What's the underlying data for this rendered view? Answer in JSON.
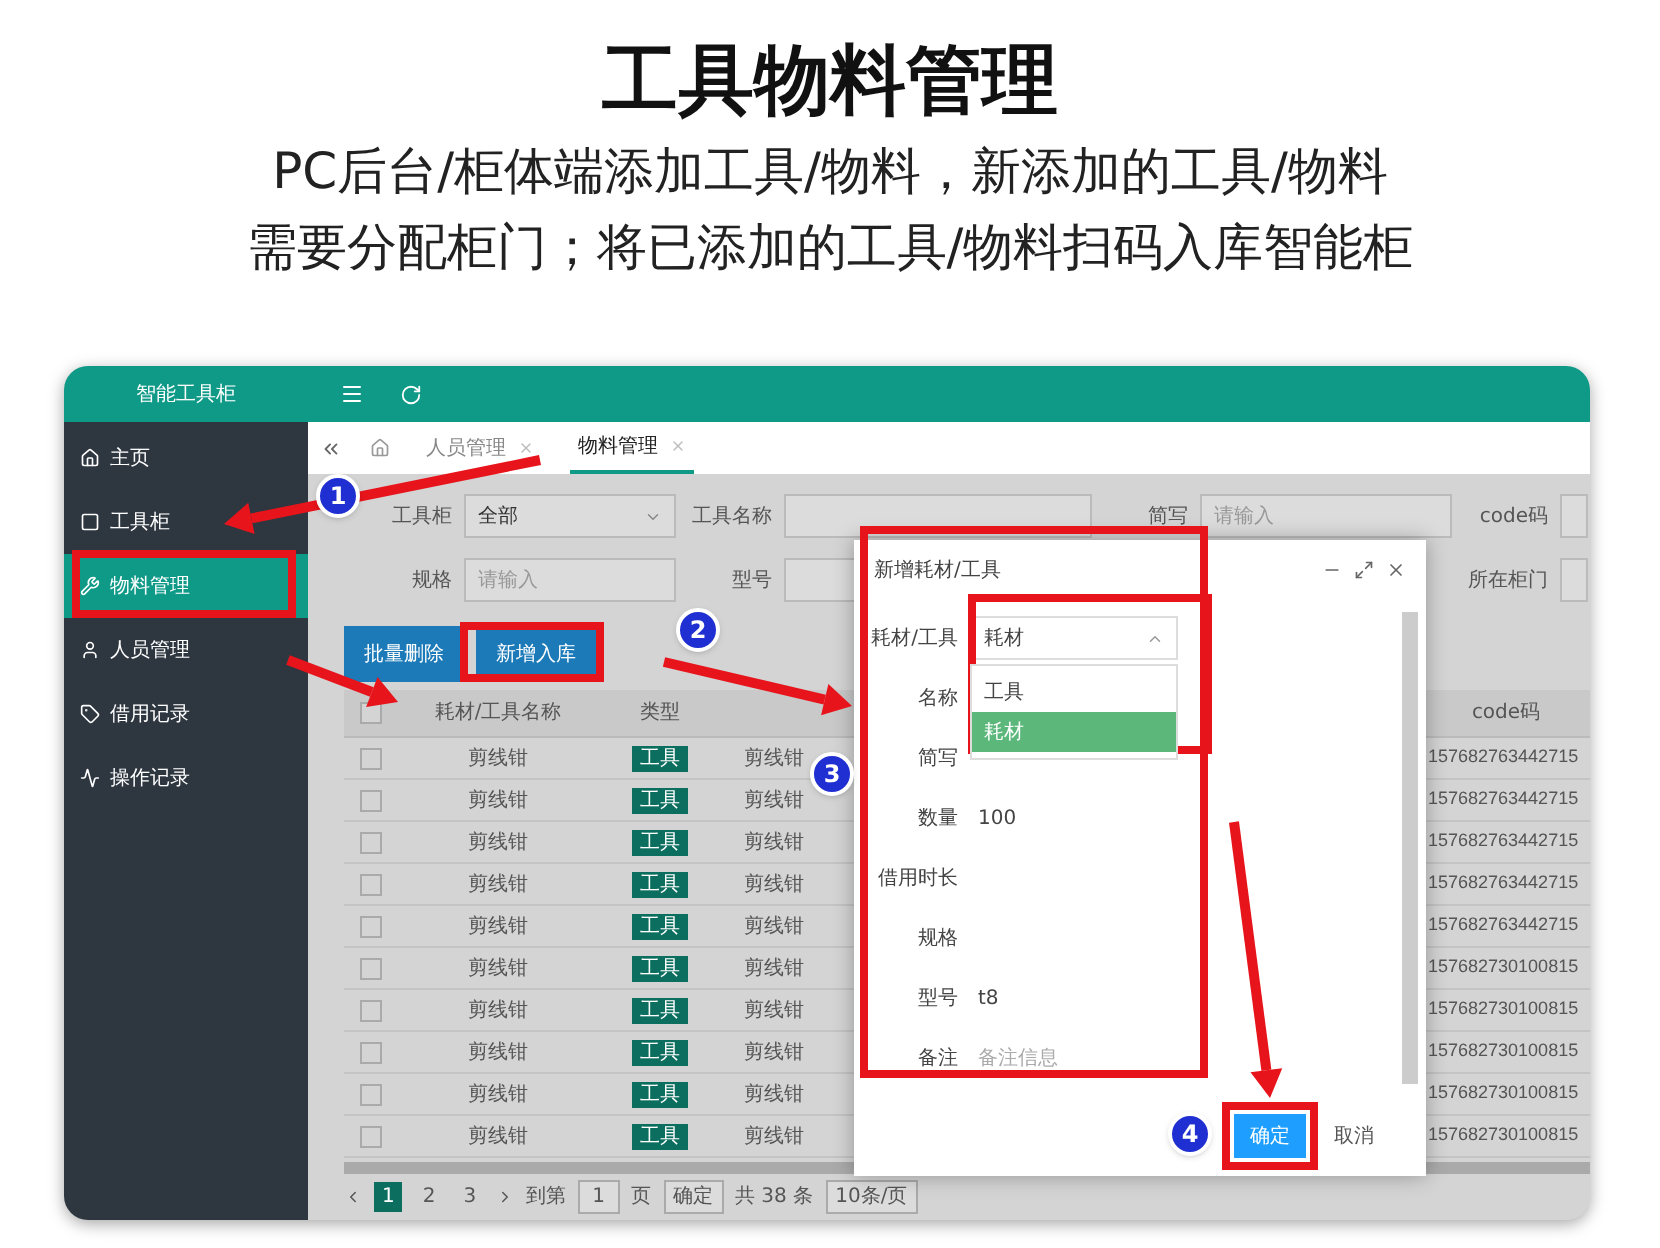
{
  "headline": {
    "title": "工具物料管理",
    "lines": [
      "PC后台/柜体端添加工具/物料，新添加的工具/物料",
      "需要分配柜门；将已添加的工具/物料扫码入库智能柜"
    ]
  },
  "app": {
    "title": "智能工具柜"
  },
  "sidebar": {
    "items": [
      {
        "label": "主页",
        "selected": false
      },
      {
        "label": "工具柜",
        "selected": false
      },
      {
        "label": "物料管理",
        "selected": true
      },
      {
        "label": "人员管理",
        "selected": false
      },
      {
        "label": "借用记录",
        "selected": false
      },
      {
        "label": "操作记录",
        "selected": false
      }
    ]
  },
  "tabs": [
    {
      "label": "人员管理",
      "selected": false
    },
    {
      "label": "物料管理",
      "selected": true
    }
  ],
  "filters": [
    [
      {
        "label": "工具柜",
        "kind": "select",
        "value": "全部"
      },
      {
        "label": "工具名称",
        "kind": "input"
      },
      {
        "label": "简写",
        "kind": "input",
        "placeholder": "请输入"
      },
      {
        "label": "code码",
        "kind": "input"
      }
    ],
    [
      {
        "label": "规格",
        "kind": "input",
        "placeholder": "请输入"
      },
      {
        "label": "型号",
        "kind": "input"
      },
      {
        "label": "所在柜门",
        "kind": "input"
      }
    ]
  ],
  "actions": [
    "批量删除",
    "新增入库"
  ],
  "table": {
    "columns": [
      "耗材/工具名称",
      "类型",
      "code码"
    ],
    "all_checked": false,
    "rows": [
      {
        "checked": false,
        "name": "剪线钳",
        "type": "工具",
        "column_3": "剪线钳",
        "code": "157682763442715"
      },
      {
        "checked": false,
        "name": "剪线钳",
        "type": "工具",
        "column_3": "剪线钳",
        "code": "157682763442715"
      },
      {
        "checked": false,
        "name": "剪线钳",
        "type": "工具",
        "column_3": "剪线钳",
        "code": "157682763442715"
      },
      {
        "checked": false,
        "name": "剪线钳",
        "type": "工具",
        "column_3": "剪线钳",
        "code": "157682763442715"
      },
      {
        "checked": false,
        "name": "剪线钳",
        "type": "工具",
        "column_3": "剪线钳",
        "code": "157682763442715"
      },
      {
        "checked": false,
        "name": "剪线钳",
        "type": "工具",
        "column_3": "剪线钳",
        "code": "157682730100815"
      },
      {
        "checked": false,
        "name": "剪线钳",
        "type": "工具",
        "column_3": "剪线钳",
        "code": "157682730100815"
      },
      {
        "checked": false,
        "name": "剪线钳",
        "type": "工具",
        "column_3": "剪线钳",
        "code": "157682730100815"
      },
      {
        "checked": false,
        "name": "剪线钳",
        "type": "工具",
        "column_3": "剪线钳",
        "code": "157682730100815"
      },
      {
        "checked": false,
        "name": "剪线钳",
        "type": "工具",
        "column_3": "剪线钳",
        "code": "157682730100815"
      }
    ]
  },
  "pagination": {
    "pages": [
      {
        "label": "1",
        "selected": true
      },
      {
        "label": "2",
        "selected": false
      },
      {
        "label": "3",
        "selected": false
      }
    ],
    "goto_label": "到第",
    "goto_value": "1",
    "page_unit": "页",
    "confirm": "确定",
    "total": "共 38 条",
    "page_size": "10条/页"
  },
  "dialog": {
    "title": "新增耗材/工具",
    "fields": [
      {
        "label": "耗材/工具",
        "kind": "select",
        "value": "耗材",
        "expanded": true,
        "options": [
          {
            "label": "工具",
            "selected": false
          },
          {
            "label": "耗材",
            "selected": true
          }
        ]
      },
      {
        "label": "名称",
        "kind": "input"
      },
      {
        "label": "简写",
        "kind": "input"
      },
      {
        "label": "数量",
        "kind": "input",
        "value": "100"
      },
      {
        "label": "借用时长",
        "kind": "input"
      },
      {
        "label": "规格",
        "kind": "input"
      },
      {
        "label": "型号",
        "kind": "input",
        "value": "t8"
      },
      {
        "label": "备注",
        "kind": "input",
        "placeholder": "备注信息"
      }
    ],
    "buttons": [
      {
        "label": "确定",
        "kind": "primary"
      },
      {
        "label": "取消",
        "kind": "plain"
      }
    ]
  },
  "steps": [
    "1",
    "2",
    "3",
    "4"
  ]
}
